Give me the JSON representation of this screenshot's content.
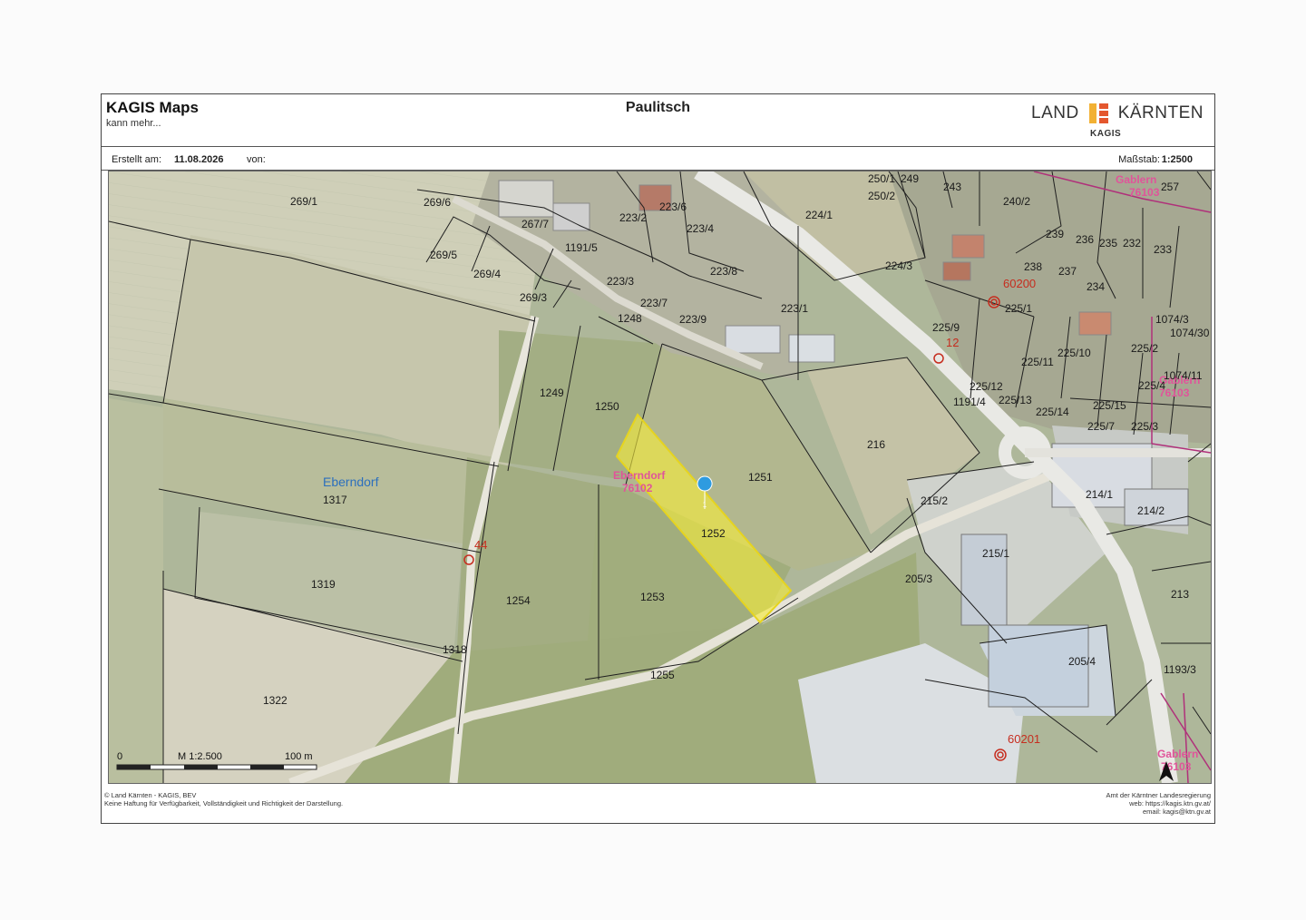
{
  "header": {
    "app_title": "KAGIS Maps",
    "app_subtitle": "kann mehr...",
    "doc_title": "Paulitsch",
    "brand_left": "LAND",
    "brand_right": "KÄRNTEN",
    "brand_sub": "KAGIS",
    "brand_colors": [
      "#e4572e",
      "#f2b134"
    ]
  },
  "info": {
    "created_label": "Erstellt am:",
    "created_value": "11.08.2026",
    "by_label": "von:",
    "scale_label": "Maßstab:",
    "scale_value": "1:2500"
  },
  "map": {
    "place_name": "Eberndorf",
    "highlighted_parcel": "1252",
    "highlight_color": "#f5ec3c",
    "marker_label": "1",
    "kg_labels": [
      {
        "name": "Eberndorf",
        "code": "76102"
      },
      {
        "name": "Gablern",
        "code": "76103"
      },
      {
        "name": "Gablern",
        "code": "76103"
      },
      {
        "name": "Gablern",
        "code": "76103"
      }
    ],
    "node_labels": [
      "44",
      "60200",
      "12",
      "60201"
    ],
    "parcels": [
      "269/1",
      "269/6",
      "267/7",
      "269/5",
      "269/4",
      "269/3",
      "1191/5",
      "223/2",
      "223/6",
      "223/4",
      "223/8",
      "223/3",
      "223/7",
      "223/9",
      "1248",
      "223/1",
      "224/1",
      "250/1",
      "249",
      "250/2",
      "243",
      "240/2",
      "239",
      "236",
      "235",
      "232",
      "233",
      "224/3",
      "238",
      "237",
      "234",
      "225/1",
      "225/9",
      "1074/3",
      "1074/30",
      "225/10",
      "225/11",
      "225/2",
      "1074/11",
      "225/4",
      "225/12",
      "225/13",
      "1191/4",
      "225/14",
      "225/15",
      "225/7",
      "225/3",
      "1249",
      "1250",
      "216",
      "1251",
      "214/1",
      "214/2",
      "1317",
      "215/2",
      "215/1",
      "1319",
      "1254",
      "1253",
      "205/3",
      "213",
      "1318",
      "205/4",
      "1255",
      "1193/3",
      "1322",
      "257"
    ],
    "scalebar": {
      "zero": "0",
      "middle": "M 1:2.500",
      "end": "100 m"
    }
  },
  "footer": {
    "left_line1": "© Land Kärnten - KAGIS, BEV",
    "left_line2": "Keine Haftung für Verfügbarkeit, Vollständigkeit und Richtigkeit der Darstellung.",
    "right_line1": "Amt der Kärntner Landesregierung",
    "right_line2": "web: https://kagis.ktn.gv.at/",
    "right_line3": "email: kagis@ktn.gv.at"
  }
}
